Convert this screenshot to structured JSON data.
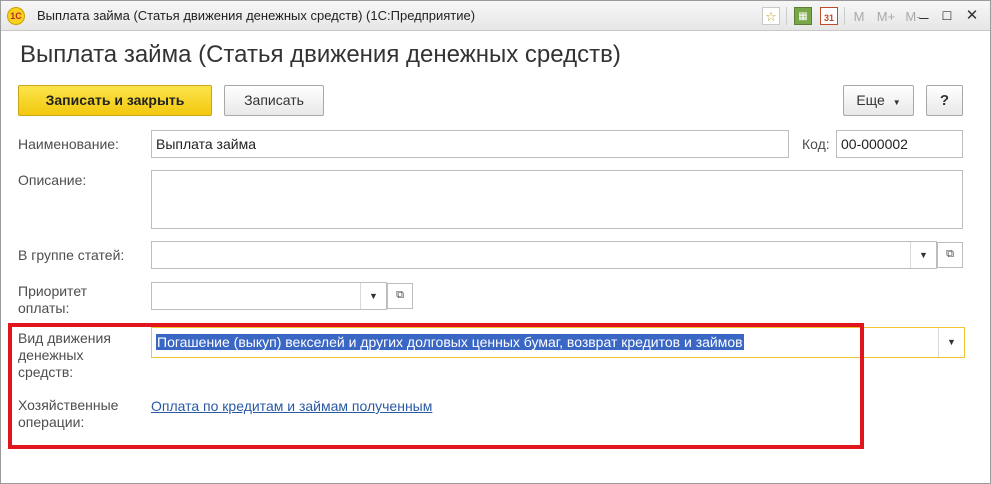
{
  "window": {
    "title": "Выплата займа (Статья движения денежных средств)  (1С:Предприятие)",
    "logo_text": "1С",
    "toolbar_icons": [
      "star-icon",
      "calculator-icon",
      "calendar-icon",
      "m-memory-icon",
      "m-plus-icon",
      "m-minus-icon",
      "minimize-icon",
      "maximize-icon",
      "close-icon"
    ],
    "calendar_label": "31",
    "m_label": "M",
    "m_plus_label": "M+",
    "m_minus_label": "M-"
  },
  "page": {
    "title": "Выплата займа (Статья движения денежных средств)"
  },
  "toolbar": {
    "save_close_label": "Записать и закрыть",
    "save_label": "Записать",
    "more_label": "Еще",
    "help_label": "?"
  },
  "form": {
    "name_label": "Наименование:",
    "name_value": "Выплата займа",
    "code_label": "Код:",
    "code_value": "00-000002",
    "description_label": "Описание:",
    "description_value": "",
    "group_label": "В группе статей:",
    "group_value": "",
    "priority_label_1": "Приоритет",
    "priority_label_2": "оплаты:",
    "priority_value": "",
    "movement_label_1": "Вид движения",
    "movement_label_2": "денежных",
    "movement_label_3": "средств:",
    "movement_value": "Погашение (выкуп) векселей и других долговых ценных бумаг, возврат кредитов и займов",
    "operations_label_1": "Хозяйственные",
    "operations_label_2": "операции:",
    "operations_link": "Оплата по кредитам и займам полученным"
  },
  "colors": {
    "primary_button": "#f2c80f",
    "highlight_border": "#e0161c",
    "link": "#2b5aa5",
    "selection": "#3a66c4",
    "focus_border": "#f0c431"
  }
}
